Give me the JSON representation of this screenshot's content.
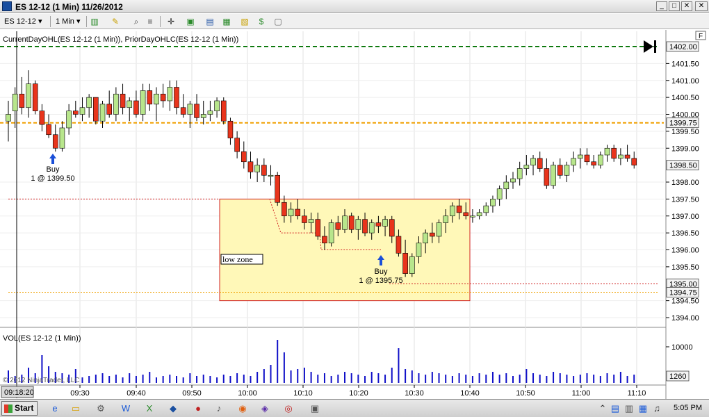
{
  "window": {
    "title": "ES 12-12 (1 Min)  11/26/2012",
    "minimize_glyph": "_",
    "maximize_glyph": "□",
    "close_glyph": "✕"
  },
  "toolbar": {
    "instrument": "ES 12-12",
    "interval": "1 Min",
    "dropdown_glyph": "▾"
  },
  "chart": {
    "indicator_label": "CurrentDayOHL(ES 12-12 (1 Min)), PriorDayOHLC(ES 12-12 (1 Min))",
    "volume_label": "VOL(ES 12-12 (1 Min))",
    "copyright": "© 2012 NinjaTrader, LLC",
    "zone_label": "low zone",
    "f_box": "F",
    "buy_marker_1": {
      "label": "Buy",
      "detail": "1 @ 1399.50"
    },
    "buy_marker_2": {
      "label": "Buy",
      "detail": "1 @ 1395.75"
    },
    "current_time_tag": "09:18:20",
    "price_ticks": [
      "1401.50",
      "1401.00",
      "1400.50",
      "1400.00",
      "1399.50",
      "1399.00",
      "1398.00",
      "1397.50",
      "1397.00",
      "1396.50",
      "1396.00",
      "1395.50",
      "1394.50",
      "1394.00"
    ],
    "price_tags": [
      {
        "text": "1402.00"
      },
      {
        "text": "1399.75"
      },
      {
        "text": "1398.50"
      },
      {
        "text": "1395.00"
      },
      {
        "text": "1394.75"
      }
    ],
    "volume_ticks": [
      "10000"
    ],
    "volume_tag": "1260",
    "time_ticks": [
      "09:30",
      "09:40",
      "09:50",
      "10:00",
      "10:10",
      "10:20",
      "10:30",
      "10:40",
      "10:50",
      "11:00",
      "11:10"
    ],
    "colors": {
      "up_candle": "#b8e68c",
      "down_candle": "#e8341c",
      "volume": "#1010c8",
      "prior_high": "#0f7a0f",
      "open_line": "#f0a000",
      "zone_fill": "#fff8b8",
      "zone_border": "#d02020",
      "buy_arrow": "#1a4fd8"
    }
  },
  "taskbar": {
    "start_label": "Start",
    "clock": "5:05 PM"
  }
}
